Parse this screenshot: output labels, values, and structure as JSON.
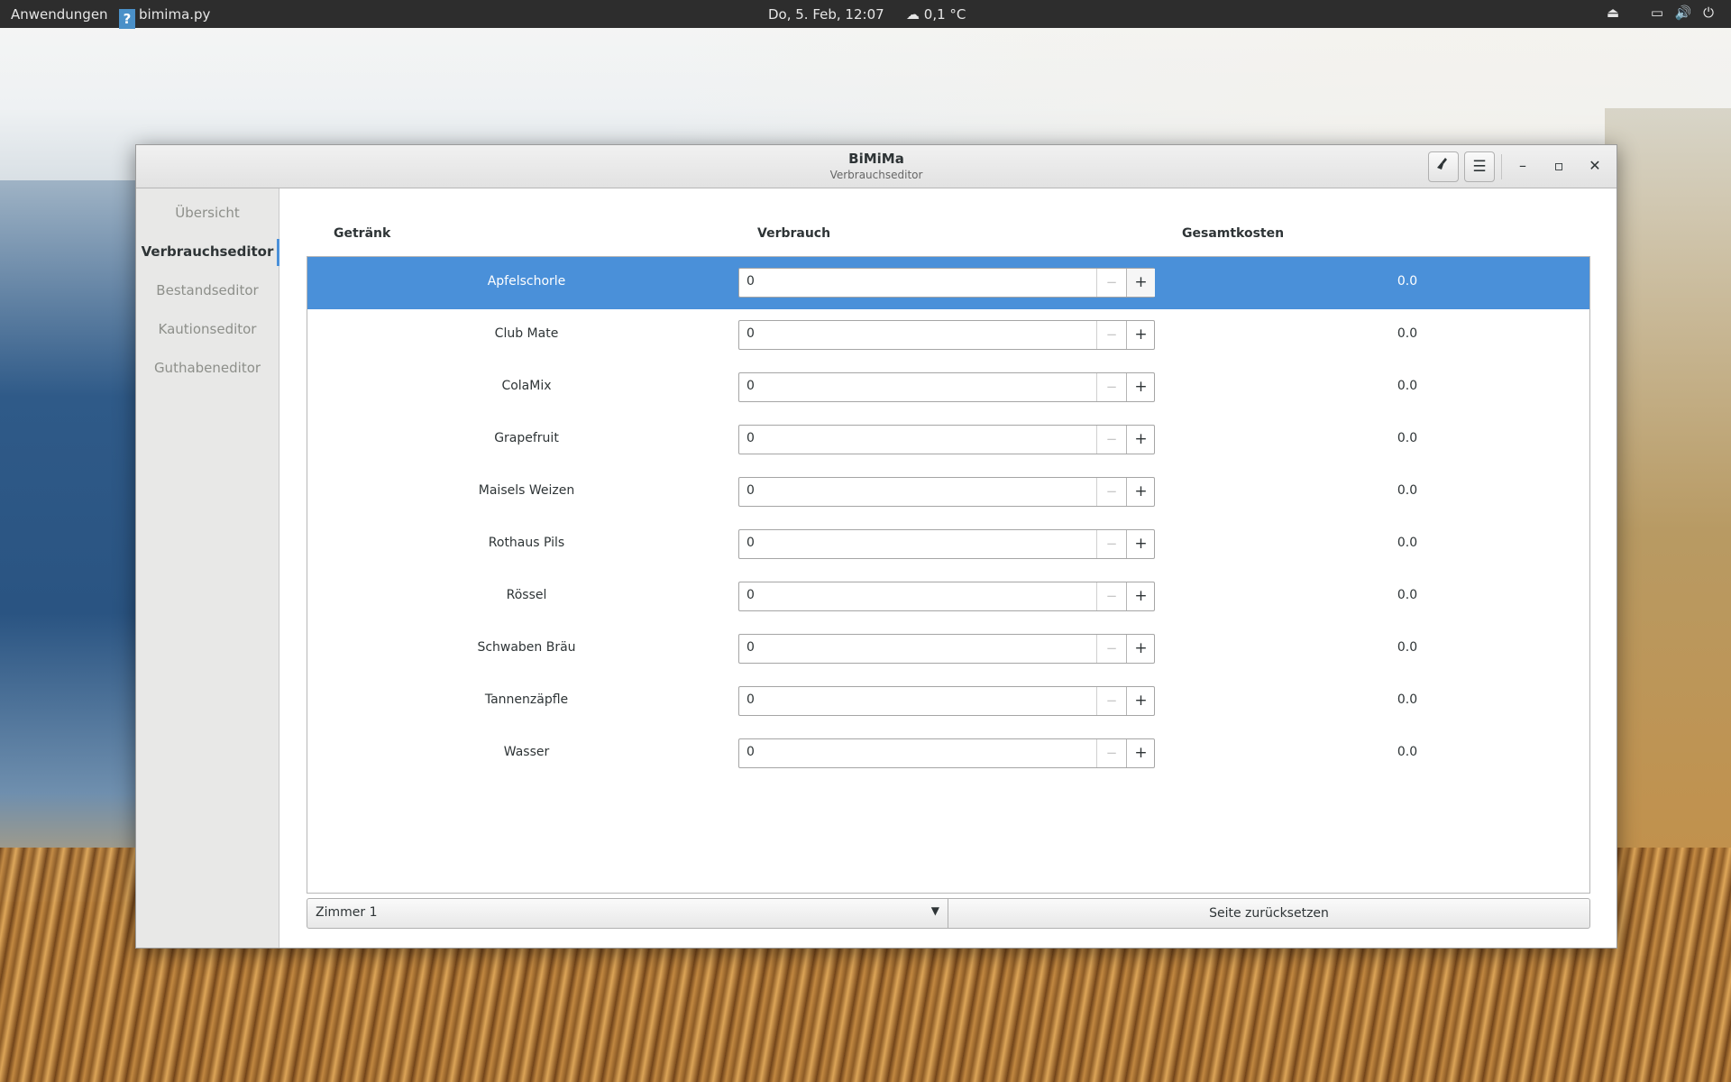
{
  "desktop": {
    "activities_label": "Anwendungen",
    "app_name": "bimima.py",
    "app_icon_glyph": "?",
    "clock": "Do,  5. Feb, 12:07",
    "weather": "0,1 °C",
    "icons": [
      "eject-icon",
      "network-icon",
      "volume-icon",
      "power-icon"
    ]
  },
  "window": {
    "title": "BiMiMa",
    "subtitle": "Verbrauchseditor",
    "buttons": {
      "clean_icon": "broom-icon",
      "menu_icon": "hamburger-menu-icon"
    }
  },
  "sidebar": {
    "items": [
      {
        "label": "Übersicht",
        "active": false
      },
      {
        "label": "Verbrauchseditor",
        "active": true
      },
      {
        "label": "Bestandseditor",
        "active": false
      },
      {
        "label": "Kautionseditor",
        "active": false
      },
      {
        "label": "Guthabeneditor",
        "active": false
      }
    ]
  },
  "table": {
    "headers": {
      "drink": "Getränk",
      "usage": "Verbrauch",
      "total": "Gesamtkosten"
    },
    "rows": [
      {
        "name": "Apfelschorle",
        "value": "0",
        "cost": "0.0",
        "selected": true
      },
      {
        "name": "Club Mate",
        "value": "0",
        "cost": "0.0"
      },
      {
        "name": "ColaMix",
        "value": "0",
        "cost": "0.0"
      },
      {
        "name": "Grapefruit",
        "value": "0",
        "cost": "0.0"
      },
      {
        "name": "Maisels Weizen",
        "value": "0",
        "cost": "0.0"
      },
      {
        "name": "Rothaus Pils",
        "value": "0",
        "cost": "0.0"
      },
      {
        "name": "Rössel",
        "value": "0",
        "cost": "0.0"
      },
      {
        "name": "Schwaben Bräu",
        "value": "0",
        "cost": "0.0"
      },
      {
        "name": "Tannenzäpfle",
        "value": "0",
        "cost": "0.0"
      },
      {
        "name": "Wasser",
        "value": "0",
        "cost": "0.0"
      }
    ]
  },
  "footer": {
    "room_select": "Zimmer 1",
    "reset_label": "Seite zurücksetzen"
  },
  "colors": {
    "accent": "#4a90d9",
    "panel": "#2d2d2d"
  }
}
